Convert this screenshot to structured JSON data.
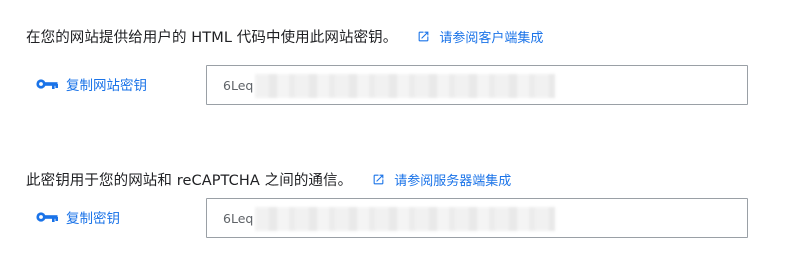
{
  "site_key": {
    "description": "在您的网站提供给用户的 HTML 代码中使用此网站密钥。",
    "doc_link_label": "请参阅客户端集成",
    "copy_label": "复制网站密钥",
    "key_value": "6Leq"
  },
  "secret_key": {
    "description": "此密钥用于您的网站和 reCAPTCHA 之间的通信。",
    "doc_link_label": "请参阅服务器端集成",
    "copy_label": "复制密钥",
    "key_value": "6Leq"
  },
  "icons": {
    "doc_link": "external-link-icon",
    "copy": "key-icon"
  },
  "colors": {
    "accent": "#1a73e8",
    "text": "#202124",
    "field_border": "#9aa0a6"
  }
}
